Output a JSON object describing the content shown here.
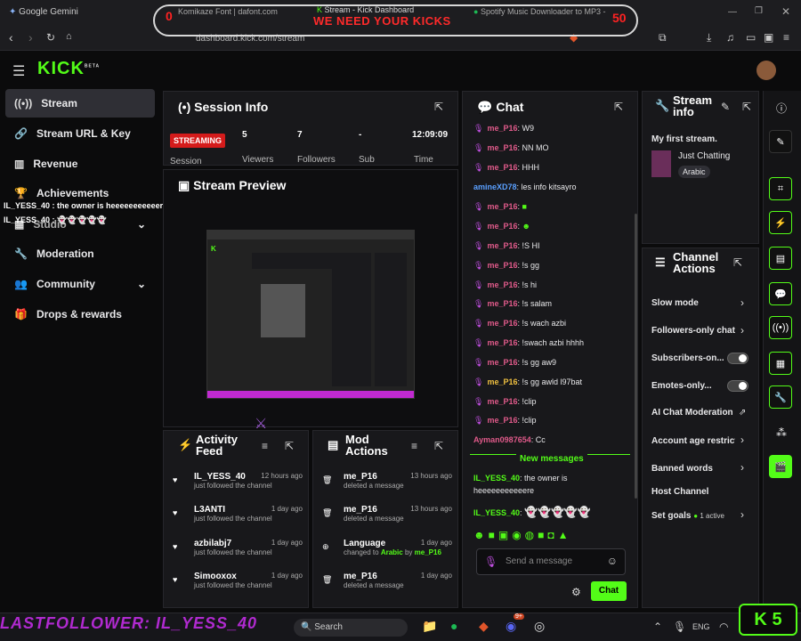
{
  "browser": {
    "tabs": [
      {
        "label": "Google Gemini"
      },
      {
        "label": "Komikaze Font | dafont.com"
      },
      {
        "label": "Stream - Kick Dashboard"
      },
      {
        "label": "Spotify Music Downloader to MP3 -"
      }
    ],
    "url": "dashboard.kick.com/stream"
  },
  "overlay": {
    "banner": "WE NEED YOUR KICKS",
    "count_left": "0",
    "count_right": "50",
    "last_follower": "LASTFOLLOWER: IL_YESS_40",
    "kick_counter": "5",
    "chat_overlay_1": "IL_YESS_40 : the owner is heeeeeeeeeeere",
    "chat_overlay_2": "IL_YESS_40 :"
  },
  "header": {
    "logo": "KICK",
    "beta": "BETA"
  },
  "sidebar": {
    "items": [
      {
        "label": "Stream"
      },
      {
        "label": "Stream URL & Key"
      },
      {
        "label": "Revenue"
      },
      {
        "label": "Achievements"
      },
      {
        "label": "Studio"
      },
      {
        "label": "Moderation"
      },
      {
        "label": "Community"
      },
      {
        "label": "Drops & rewards"
      }
    ]
  },
  "session": {
    "title": "Session Info",
    "badge": "STREAMING",
    "badge_label": "Session",
    "viewers": "5",
    "viewers_label": "Viewers",
    "followers": "7",
    "followers_label": "Followers",
    "sub": "-",
    "sub_label": "Sub",
    "time": "12:09:09",
    "time_label": "Time"
  },
  "preview": {
    "title": "Stream Preview"
  },
  "activity": {
    "title": "Activity Feed",
    "items": [
      {
        "name": "IL_YESS_40",
        "time": "12 hours ago",
        "desc": "just followed the channel"
      },
      {
        "name": "L3ANTI",
        "time": "1 day ago",
        "desc": "just followed the channel"
      },
      {
        "name": "azbilabj7",
        "time": "1 day ago",
        "desc": "just followed the channel"
      },
      {
        "name": "Simooxox",
        "time": "1 day ago",
        "desc": "just followed the channel"
      }
    ]
  },
  "mod": {
    "title": "Mod Actions",
    "items": [
      {
        "name": "me_P16",
        "time": "13 hours ago",
        "desc": "deleted a message"
      },
      {
        "name": "me_P16",
        "time": "13 hours ago",
        "desc": "deleted a message"
      },
      {
        "name": "Language",
        "time": "1 day ago",
        "desc": "changed to",
        "arabic": "Arabic",
        "by": "by",
        "who": "me_P16"
      },
      {
        "name": "me_P16",
        "time": "1 day ago",
        "desc": "deleted a message"
      }
    ]
  },
  "chat": {
    "title": "Chat",
    "messages": [
      {
        "user": "me_P16",
        "text": ": W9"
      },
      {
        "user": "me_P16",
        "text": ": NN MO"
      },
      {
        "user": "me_P16",
        "text": ": HHH"
      },
      {
        "user": "amineXD78",
        "text": ": les info kitsayro"
      },
      {
        "user": "me_P16",
        "text": ": "
      },
      {
        "user": "me_P16",
        "text": ": "
      },
      {
        "user": "me_P16",
        "text": ": !S HI"
      },
      {
        "user": "me_P16",
        "text": ": !s gg"
      },
      {
        "user": "me_P16",
        "text": ": !s hi"
      },
      {
        "user": "me_P16",
        "text": ": !s salam"
      },
      {
        "user": "me_P16",
        "text": ": !s wach azbi"
      },
      {
        "user": "me_P16",
        "text": ": !swach azbi hhhh"
      },
      {
        "user": "me_P16",
        "text": ": !s gg aw9"
      },
      {
        "user": "me_P16",
        "text": ": !s gg awld l97bat"
      },
      {
        "user": "me_P16",
        "text": ": !clip"
      },
      {
        "user": "me_P16",
        "text": ": !clip"
      },
      {
        "user": "Ayman0987654",
        "text": ": Cc"
      }
    ],
    "new_messages": "New messages",
    "msg_a_user": "IL_YESS_40",
    "msg_a_text": ": the owner is",
    "msg_a_text2": "heeeeeeeeeeere",
    "msg_b_user": "IL_YESS_40",
    "msg_b_text": ":",
    "placeholder": "Send a message",
    "send": "Chat"
  },
  "streaminfo": {
    "title": "Stream info",
    "stream_title": "My first stream.",
    "category": "Just Chatting",
    "language": "Arabic"
  },
  "actions": {
    "title": "Channel Actions",
    "items": [
      {
        "label": "Slow mode"
      },
      {
        "label": "Followers-only chat"
      },
      {
        "label": "Subscribers-on..."
      },
      {
        "label": "Emotes-only..."
      },
      {
        "label": "AI Chat Moderation"
      },
      {
        "label": "Account age restrictions"
      },
      {
        "label": "Banned words"
      },
      {
        "label": "Host Channel"
      },
      {
        "label": "Set goals"
      }
    ],
    "goals_active": "1 active"
  },
  "taskbar": {
    "search": "Search",
    "lang": "ENG",
    "badge": "9+"
  },
  "colors": {
    "accent": "#53fc18",
    "panel": "#18181b",
    "bg": "#0b0b0c",
    "username": "#e05a8a"
  }
}
